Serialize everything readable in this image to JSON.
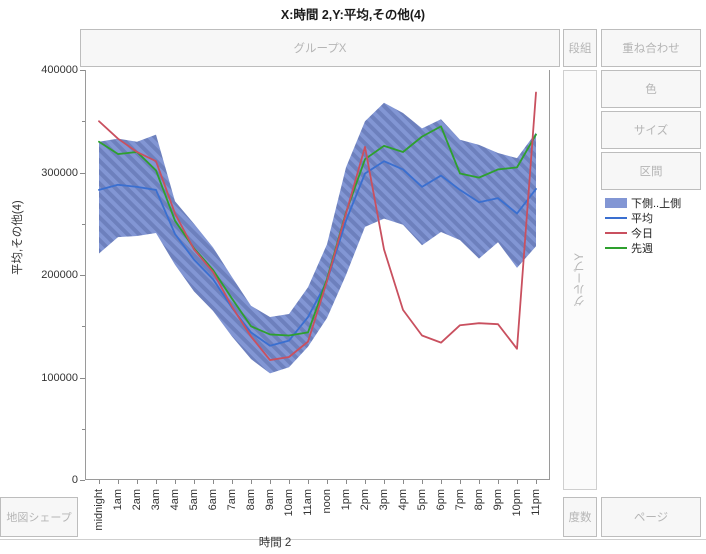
{
  "title": "X:時間 2,Y:平均,その他(4)",
  "zones": {
    "group_x": "グループX",
    "group_y": "グループY",
    "dankumi": "段組",
    "overlay": "重ね合わせ",
    "color": "色",
    "size": "サイズ",
    "interval": "区間",
    "map_shape": "地図シェープ",
    "frequency": "度数",
    "page": "ページ"
  },
  "legend": {
    "items": [
      {
        "label": "下側..上側",
        "type": "band",
        "color": "#8296d4"
      },
      {
        "label": "平均",
        "type": "line",
        "color": "#3a6fd0"
      },
      {
        "label": "今日",
        "type": "line",
        "color": "#c9505f"
      },
      {
        "label": "先週",
        "type": "line",
        "color": "#2ea02e"
      }
    ]
  },
  "colors": {
    "band_fill": "#8296d4",
    "band_hatch": "#6b7fbd",
    "mean_line": "#3a6fd0",
    "today_line": "#c9505f",
    "lastweek_line": "#2ea02e",
    "axis": "#8a8a8a",
    "frame": "#9a9a9a",
    "zone_text": "#b5b5b5"
  },
  "chart_data": {
    "type": "line",
    "title": "X:時間 2,Y:平均,その他(4)",
    "xlabel": "時間 2",
    "ylabel": "平均,その他(4)",
    "ylim": [
      0,
      400000
    ],
    "y_ticks": [
      0,
      100000,
      200000,
      300000,
      400000
    ],
    "y_minor_ticks": [
      50000,
      150000,
      250000,
      350000
    ],
    "grid": false,
    "legend_position": "right",
    "categories": [
      "midnight",
      "1am",
      "2am",
      "3am",
      "4am",
      "5am",
      "6am",
      "7am",
      "8am",
      "9am",
      "10am",
      "11am",
      "noon",
      "1pm",
      "2pm",
      "3pm",
      "4pm",
      "5pm",
      "6pm",
      "7pm",
      "8pm",
      "9pm",
      "10pm",
      "11pm"
    ],
    "series": [
      {
        "name": "下側..上側",
        "type": "band",
        "lower": [
          221000,
          237000,
          238000,
          241000,
          210000,
          184000,
          165000,
          140000,
          118000,
          104000,
          110000,
          130000,
          158000,
          200000,
          247000,
          255000,
          249000,
          229000,
          242000,
          234000,
          216000,
          232000,
          207000,
          228000
        ],
        "upper": [
          330000,
          333000,
          330000,
          337000,
          272000,
          250000,
          227000,
          198000,
          170000,
          159000,
          162000,
          188000,
          230000,
          305000,
          350000,
          368000,
          358000,
          343000,
          352000,
          332000,
          327000,
          319000,
          314000,
          339000
        ]
      },
      {
        "name": "平均",
        "type": "line",
        "color": "#3a6fd0",
        "values": [
          283000,
          288000,
          286000,
          283000,
          240000,
          215000,
          196000,
          168000,
          144000,
          131000,
          136000,
          159000,
          194000,
          253000,
          299000,
          311000,
          303000,
          286000,
          297000,
          283000,
          271000,
          275000,
          260000,
          284000
        ]
      },
      {
        "name": "今日",
        "type": "line",
        "color": "#c9505f",
        "values": [
          350000,
          333000,
          320000,
          311000,
          260000,
          225000,
          203000,
          169000,
          140000,
          117000,
          120000,
          135000,
          194000,
          260000,
          325000,
          225000,
          166000,
          141000,
          134000,
          151000,
          153000,
          152000,
          128000,
          378000
        ]
      },
      {
        "name": "先週",
        "type": "line",
        "color": "#2ea02e",
        "values": [
          330000,
          318000,
          320000,
          302000,
          253000,
          226000,
          205000,
          177000,
          150000,
          142000,
          141000,
          144000,
          196000,
          261000,
          313000,
          326000,
          320000,
          335000,
          345000,
          299000,
          295000,
          303000,
          305000,
          337000
        ]
      }
    ]
  }
}
